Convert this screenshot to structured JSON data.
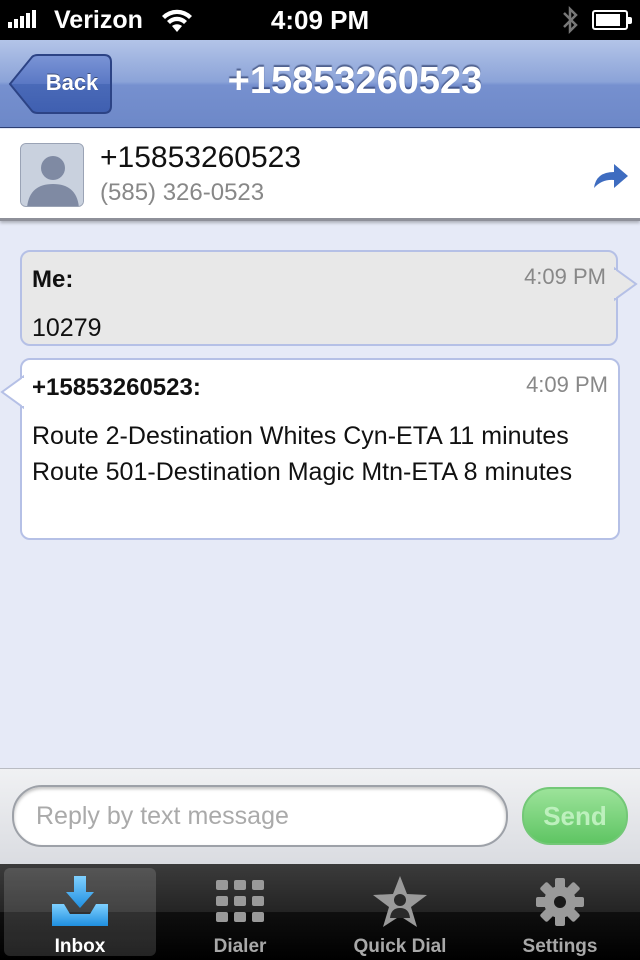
{
  "status_bar": {
    "carrier": "Verizon",
    "time": "4:09 PM",
    "battery_level_pct": 85
  },
  "nav": {
    "back_label": "Back",
    "title": "+15853260523"
  },
  "contact": {
    "name": "+15853260523",
    "phone": "(585) 326-0523"
  },
  "messages": [
    {
      "sender": "Me:",
      "time": "4:09 PM",
      "text": "10279"
    },
    {
      "sender": "+15853260523:",
      "time": "4:09 PM",
      "text": "Route 2-Destination Whites Cyn-ETA 11 minutes Route 501-Destination Magic Mtn-ETA 8 minutes"
    }
  ],
  "reply": {
    "placeholder": "Reply by text message",
    "send_label": "Send"
  },
  "tabs": [
    {
      "label": "Inbox",
      "icon": "inbox-download-icon",
      "active": true
    },
    {
      "label": "Dialer",
      "icon": "keypad-grid-icon",
      "active": false
    },
    {
      "label": "Quick Dial",
      "icon": "star-person-icon",
      "active": false
    },
    {
      "label": "Settings",
      "icon": "gear-icon",
      "active": false
    }
  ],
  "colors": {
    "nav_blue": "#7690cf",
    "send_green": "#5fc563",
    "bubble_border": "#b5c0e6",
    "background": "#e6eaf7"
  }
}
